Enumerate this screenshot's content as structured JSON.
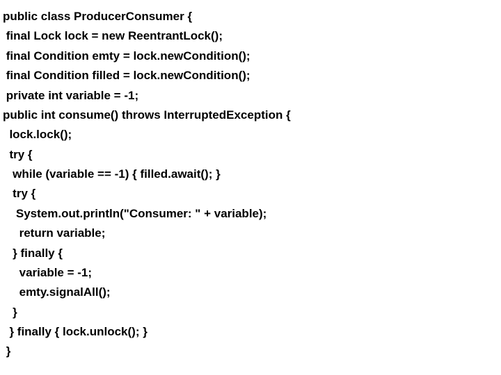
{
  "lines": [
    "public class ProducerConsumer {",
    " final Lock lock = new ReentrantLock();",
    " final Condition emty = lock.newCondition();",
    " final Condition filled = lock.newCondition();",
    " private int variable = -1;",
    "public int consume() throws InterruptedException {",
    "  lock.lock();",
    "  try {",
    "   while (variable == -1) { filled.await(); }",
    "   try {",
    "    System.out.println(\"Consumer: \" + variable);",
    "     return variable;",
    "   } finally {",
    "     variable = -1;",
    "     emty.signalAll();",
    "   }",
    "  } finally { lock.unlock(); }",
    " }"
  ]
}
